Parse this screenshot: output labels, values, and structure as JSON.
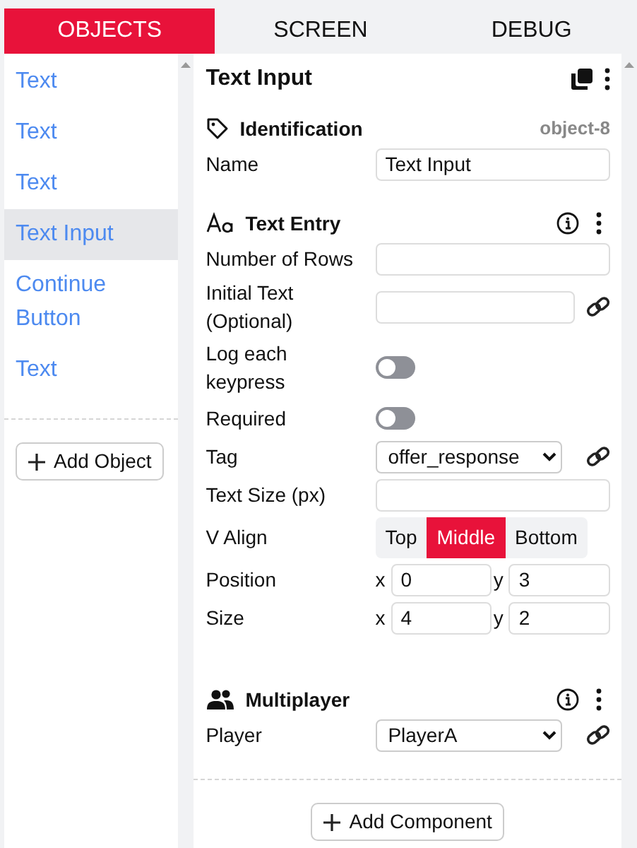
{
  "tabs": [
    {
      "label": "OBJECTS",
      "selected": true
    },
    {
      "label": "SCREEN",
      "selected": false
    },
    {
      "label": "DEBUG",
      "selected": false
    }
  ],
  "objects": {
    "items": [
      {
        "label": "Text",
        "selected": false
      },
      {
        "label": "Text",
        "selected": false
      },
      {
        "label": "Text",
        "selected": false
      },
      {
        "label": "Text Input",
        "selected": true
      },
      {
        "label": "Continue Button",
        "selected": false
      },
      {
        "label": "Text",
        "selected": false
      }
    ],
    "add_button": "Add Object"
  },
  "inspector": {
    "title": "Text Input",
    "sections": [
      {
        "title": "Identification",
        "badge": "object-8",
        "fields": [
          {
            "kind": "text",
            "label": "Name",
            "value": "Text Input"
          }
        ]
      },
      {
        "title": "Text Entry",
        "info": true,
        "menu": true,
        "fields": [
          {
            "kind": "text",
            "label": "Number of Rows"
          },
          {
            "kind": "text",
            "label": "Initial Text (Optional)",
            "link": true
          },
          {
            "kind": "toggle",
            "label": "Log each keypress",
            "on": false
          },
          {
            "kind": "toggle",
            "label": "Required",
            "on": false
          },
          {
            "kind": "select",
            "label": "Tag",
            "value": "offer_response",
            "link": true
          },
          {
            "kind": "text",
            "label": "Text Size (px)"
          },
          {
            "kind": "segmented",
            "label": "V Align",
            "options": [
              {
                "label": "Top",
                "selected": false
              },
              {
                "label": "Middle",
                "selected": true
              },
              {
                "label": "Bottom",
                "selected": false
              }
            ]
          },
          {
            "kind": "xy",
            "label": "Position",
            "parts": [
              {
                "prefix": "x",
                "value": "0"
              },
              {
                "prefix": "y",
                "value": "3"
              }
            ]
          },
          {
            "kind": "xy",
            "label": "Size",
            "parts": [
              {
                "prefix": "x",
                "value": "4"
              },
              {
                "prefix": "y",
                "value": "2"
              }
            ]
          }
        ]
      },
      {
        "title": "Multiplayer",
        "info": true,
        "menu": true,
        "fields": [
          {
            "kind": "select",
            "label": "Player",
            "value": "PlayerA",
            "link": true
          }
        ]
      }
    ],
    "add_button": "Add Component"
  }
}
